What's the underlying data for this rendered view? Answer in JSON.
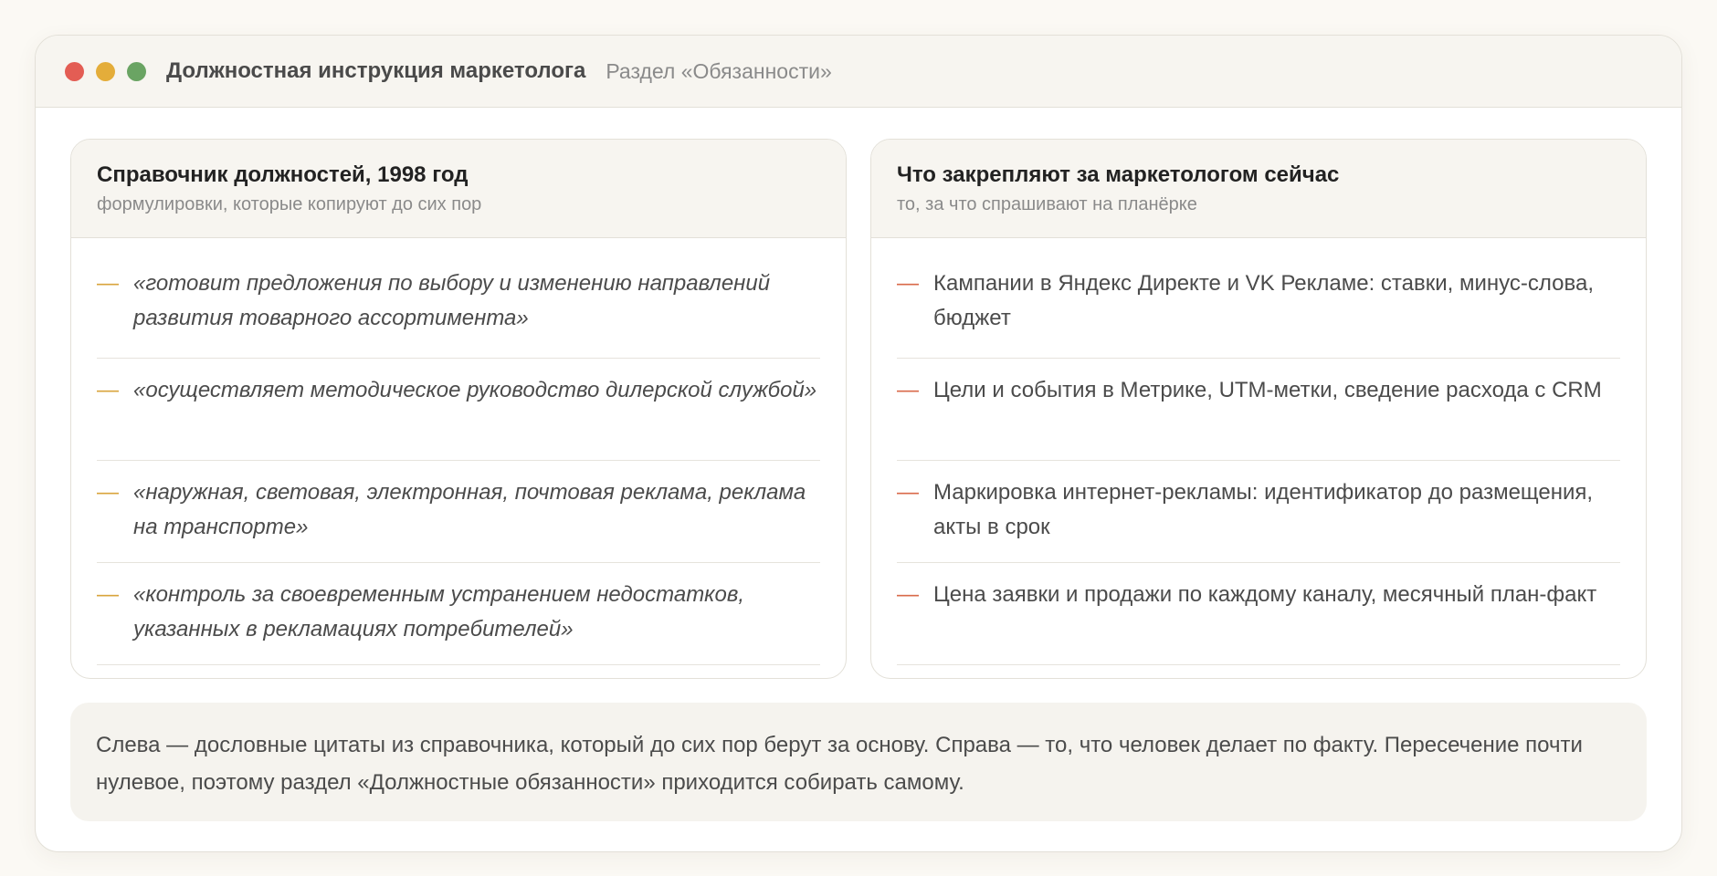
{
  "window": {
    "title": "Должностная инструкция маркетолога",
    "subtitle": "Раздел «Обязанности»"
  },
  "left_panel": {
    "title": "Справочник должностей, 1998 год",
    "subtitle": "формулировки, которые копируют до сих пор",
    "items": [
      "«готовит предложения по выбору и изменению направлений развития товарного ассортимента»",
      "«осуществляет методическое руководство дилерской службой»",
      "«наружная, световая, электронная, почтовая реклама, реклама на транспорте»",
      "«контроль за своевременным устранением недостатков, указанных в рекламациях потребителей»"
    ]
  },
  "right_panel": {
    "title": "Что закрепляют за маркетологом сейчас",
    "subtitle": "то, за что спрашивают на планёрке",
    "items": [
      "Кампании в Яндекс Директе и VK Рекламе: ставки, минус‑слова, бюджет",
      "Цели и события в Метрике, UTM‑метки, сведение расхода с CRM",
      "Маркировка интернет‑рекламы: идентификатор до размещения, акты в срок",
      "Цена заявки и продажи по каждому каналу, месячный план‑факт"
    ]
  },
  "dash_glyph": "—",
  "note": "Слева — дословные цитаты из справочника, который до сих пор берут за основу. Справа — то, что человек делает по факту. Пересечение почти нулевое, поэтому раздел «Должностные обязанности» приходится собирать самому.",
  "colors": {
    "dot_close": "#e35d54",
    "dot_minimize": "#e4ad3a",
    "dot_maximize": "#6aa463",
    "dash_left": "#d9a43c",
    "dash_right": "#d96a4a"
  }
}
